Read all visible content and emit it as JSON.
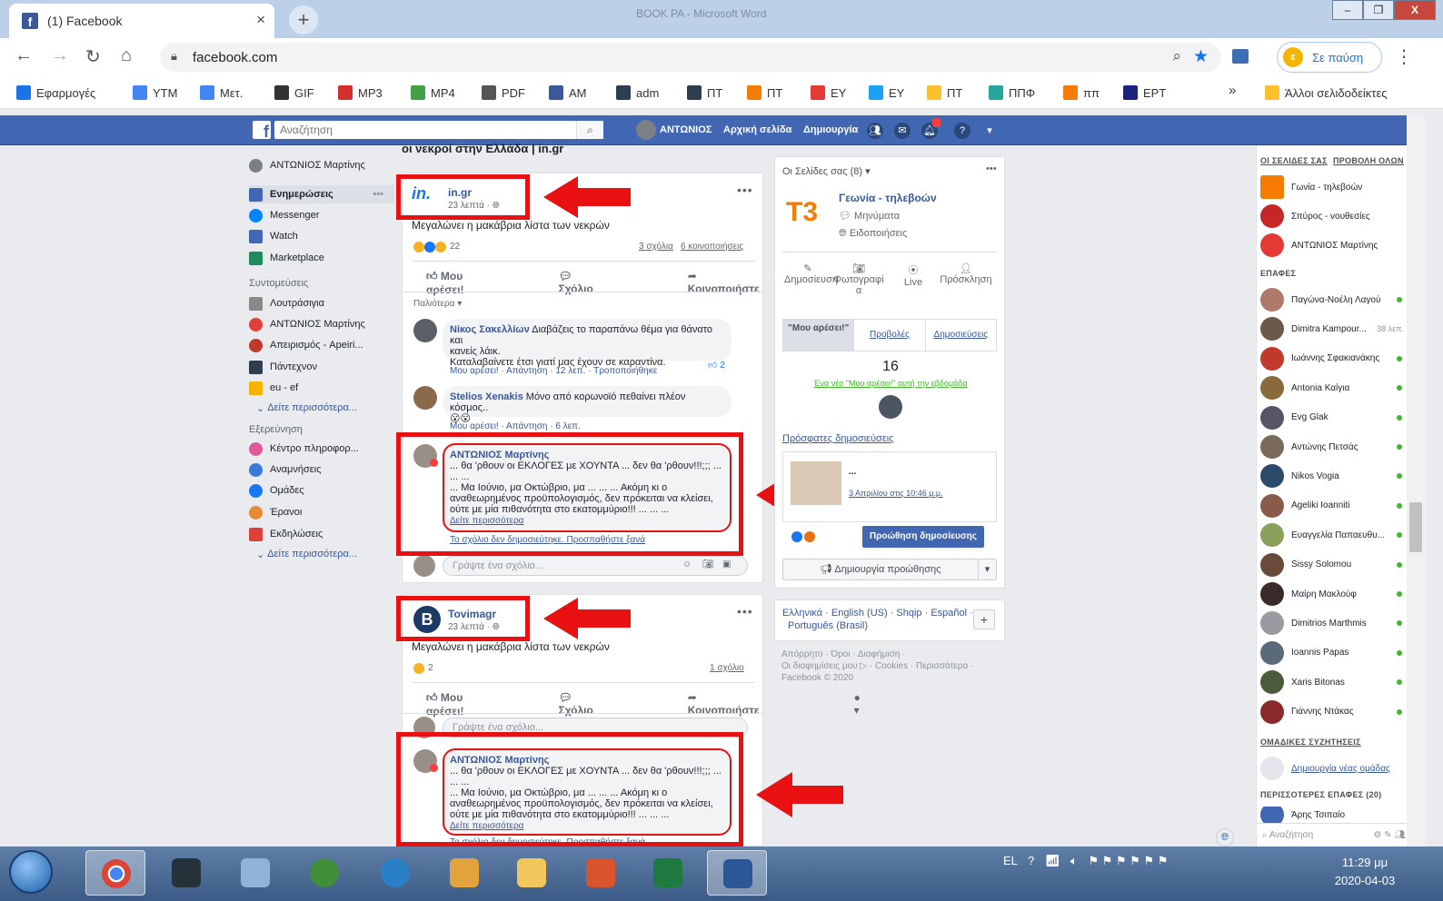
{
  "browser": {
    "tab_title": "(1) Facebook",
    "tab_close": "×",
    "new_tab": "+",
    "window_title": "BOOK PA - Microsoft Word",
    "url": "facebook.com",
    "profile_label": "Σε παύση",
    "bookmarks": [
      {
        "label": "Εφαρμογές",
        "icon": "apps-grid-icon",
        "color": "#1a73e8"
      },
      {
        "label": "YTM",
        "icon": "google-g-icon",
        "color": "#4285f4"
      },
      {
        "label": "Μετ.",
        "icon": "translate-icon",
        "color": "#4285f4"
      },
      {
        "label": "GIF",
        "icon": "globe-icon",
        "color": "#333333"
      },
      {
        "label": "MP3",
        "icon": "youtube-mp3-icon",
        "color": "#d32f2f"
      },
      {
        "label": "MP4",
        "icon": "download-arrow-icon",
        "color": "#43a047"
      },
      {
        "label": "PDF",
        "icon": "pdf-icon",
        "color": "#555555"
      },
      {
        "label": "AM",
        "icon": "facebook-icon",
        "color": "#3b5998"
      },
      {
        "label": "adm",
        "icon": "tool-icon",
        "color": "#2c3e50"
      },
      {
        "label": "ΠΤ",
        "icon": "tool-icon",
        "color": "#2c3e50"
      },
      {
        "label": "ΠΤ",
        "icon": "analytics-icon",
        "color": "#f57c00"
      },
      {
        "label": "EY",
        "icon": "youtube-icon",
        "color": "#e53935"
      },
      {
        "label": "EY",
        "icon": "twitter-icon",
        "color": "#1da1f2"
      },
      {
        "label": "ΠΤ",
        "icon": "folder-icon",
        "color": "#fbc02d"
      },
      {
        "label": "ΠΠΦ",
        "icon": "circle-pp-icon",
        "color": "#26a69a"
      },
      {
        "label": "ππ",
        "icon": "analytics-icon",
        "color": "#f57c00"
      },
      {
        "label": "ΕΡΤ",
        "icon": "ert-icon",
        "color": "#1a237e"
      }
    ],
    "bookmarks_more": "»",
    "other_bookmarks": "Άλλοι σελιδοδείκτες"
  },
  "fb_header": {
    "search_placeholder": "Αναζήτηση",
    "user": "ΑΝΤΩΝΙΟΣ",
    "home": "Αρχική σελίδα",
    "create": "Δημιουργία",
    "notifications_count": "1"
  },
  "left_nav": {
    "profile": "ΑΝΤΩΝΙΟΣ Μαρτίνης",
    "news_feed": "Ενημερώσεις",
    "messenger": "Messenger",
    "watch": "Watch",
    "marketplace": "Marketplace",
    "shortcuts_header": "Συντομεύσεις",
    "shortcuts": [
      "Λουτράσιγια",
      "ΑΝΤΩΝΙΟΣ Μαρτίνης",
      "Απειρισμός - Apeiri...",
      "Πάντεχνον",
      "eu - ef"
    ],
    "see_more_1": "Δείτε περισσότερα...",
    "explore_header": "Εξερεύνηση",
    "explore": [
      "Κέντρο πληροφορ...",
      "Αναμνήσεις",
      "Ομάδες",
      "Έρανοι",
      "Εκδηλώσεις"
    ],
    "see_more_2": "Δείτε περισσότερα..."
  },
  "feed": {
    "top_heading": "οι νεκροί στην Ελλάδα | in.gr",
    "post1": {
      "page": "in.gr",
      "time": "23 λεπτά · ",
      "text": "Μεγαλώνει η μακάβρια λίστα των νεκρών",
      "reaction_count": "22",
      "comments_count": "3 σχόλια",
      "shares_count": "6 κοινοποιήσεις",
      "like": "Μου αρέσει!",
      "comment": "Σχόλιο",
      "share": "Κοινοποιήστε",
      "sort": "Παλιότερα ▾",
      "comments": [
        {
          "name": "Νίκος Σακελλίων",
          "text1": "Διαβάζεις το παραπάνω θέμα για θάνατο και",
          "text2": "κανείς λάικ.",
          "text3": "Καταλαβαίνετε έτσι γιατί μας έχουν σε καραντίνα.",
          "meta": "Μου αρέσει! · Απάντηση · 12 λεπ. · Τροποποιήθηκε",
          "likes": "2"
        },
        {
          "name": "Stelios Xenakis",
          "text1": "Μόνο από κορωνοϊό πεθαίνει πλέον κόσμος..",
          "text2": "😮😮",
          "meta": "Μου αρέσει! · Απάντηση · 6 λεπ."
        }
      ],
      "my_comment": {
        "name": "ΑΝΤΩΝΙΟΣ Μαρτίνης",
        "line1": "... θα 'ρθουν οι ΕΚΛΟΓΕΣ με ΧΟΥΝΤΑ ... δεν θα 'ρθουν!!!;;; ...",
        "line2": "... ...",
        "line3": "... Μα Ιούνιο, μα Οκτώβριο, μα ... ... ... Ακόμη κι ο",
        "line4": "αναθεωρημένος προϋπολογισμός, δεν πρόκειται να κλείσει,",
        "line5": "ούτε με μία πιθανότητα στο εκατομμύριο!!! ... ... ...",
        "see_more": "Δείτε περισσότερα",
        "error": "Το σχόλιο δεν δημοσιεύτηκε. Προσπαθήστε ξανά"
      },
      "write_comment": "Γράψτε ένα σχόλιο..."
    },
    "post2": {
      "page": "Tovimagr",
      "time": "23 λεπτά · ",
      "text": "Μεγαλώνει η μακάβρια λίστα των νεκρών",
      "reaction_count": "2",
      "comments_count": "1 σχόλιο",
      "like": "Μου αρέσει!",
      "comment": "Σχόλιο",
      "share": "Κοινοποιήστε",
      "write_comment": "Γράψτε ένα σχόλιο...",
      "my_comment": {
        "name": "ΑΝΤΩΝΙΟΣ Μαρτίνης",
        "line1": "... θα 'ρθουν οι ΕΚΛΟΓΕΣ με ΧΟΥΝΤΑ ... δεν θα 'ρθουν!!!;;; ...",
        "line2": "... ...",
        "line3": "... Μα Ιούνιο, μα Οκτώβριο, μα ... ... ... Ακόμη κι ο",
        "line4": "αναθεωρημένος προϋπολογισμός, δεν πρόκειται να κλείσει,",
        "line5": "ούτε με μία πιθανότητα στο εκατομμύριο!!! ... ... ...",
        "see_more": "Δείτε περισσότερα",
        "error": "Το σχόλιο δεν δημοσιεύτηκε. Προσπαθήστε ξανά"
      }
    }
  },
  "pages_box": {
    "header": "Οι Σελίδες σας (8) ▾",
    "page_name": "Γεωνία - τηλεβοών",
    "messages": "Μηνύματα",
    "notifications": "Ειδοποιήσεις",
    "actions": [
      "Δημοσίευση",
      "Φωτογραφί α",
      "Live",
      "Πρόσκληση"
    ],
    "tabs": [
      "\"Μου αρέσει!\"",
      "Προβολές",
      "Δημοσιεύσεις"
    ],
    "likes_count": "16",
    "new_like": "Ένα νέο \"Μου αρέσει!\" αυτή την εβδομάδα",
    "recent_posts": "Πρόσφατες δημοσιεύσεις",
    "recent_title": "...",
    "recent_date": "3 Απριλίου στις 10:46 μ.μ.",
    "boost": "Προώθηση δημοσίευσης",
    "create_promo": "Δημιουργία προώθησης"
  },
  "languages": {
    "line1": "Ελληνικά · English (US) · Shqip · Español ·",
    "line2": "Português (Brasil)",
    "add": "+"
  },
  "footer_links": {
    "line1": "Απόρρητο · Όροι · Διαφήμιση ·",
    "line2": "Οι διαφημίσεις μου ▷ · Cookies · Περισσότερα ·",
    "line3": "Facebook © 2020"
  },
  "chat": {
    "hdr_pages": "ΟΙ ΣΕΛΙΔΕΣ ΣΑΣ",
    "hdr_showall": "ΠΡΟΒΟΛΗ ΟΛΩΝ",
    "pages": [
      "Γωνία - τηλεβοών",
      "Σπύρος - vουθεσίες",
      "ΑΝΤΩΝΙΟΣ Μαρτίνης"
    ],
    "hdr_contacts": "ΕΠΑΦΕΣ",
    "contacts": [
      {
        "name": "Παγώνα-Νοέλη Λαγού",
        "time": ""
      },
      {
        "name": "Dimitra Kampour...",
        "time": "38 λεπ."
      },
      {
        "name": "Ιωάννης Σφακιανάκης",
        "time": ""
      },
      {
        "name": "Antonia Καίγια",
        "time": ""
      },
      {
        "name": "Evg Glak",
        "time": ""
      },
      {
        "name": "Αντώνης Πετσάς",
        "time": ""
      },
      {
        "name": "Nikos Vogia",
        "time": ""
      },
      {
        "name": "Ageliki Ioanniti",
        "time": ""
      },
      {
        "name": "Ευαγγελία Παπαευθυ...",
        "time": ""
      },
      {
        "name": "Sissy Solomou",
        "time": ""
      },
      {
        "name": "Μαίρη Μακλούφ",
        "time": ""
      },
      {
        "name": "Dimitrios Marthmis",
        "time": ""
      },
      {
        "name": "Ioannis Papas",
        "time": ""
      },
      {
        "name": "Xaris Bitonas",
        "time": ""
      },
      {
        "name": "Γιάννης Ντάκας",
        "time": ""
      }
    ],
    "hdr_groups": "ΟΜΑΔΙΚΕΣ ΣΥΖΗΤΗΣΕΙΣ",
    "create_group": "Δημιουργία νέας ομάδας",
    "hdr_more": "ΠΕΡΙΣΣΟΤΕΡΕΣ ΕΠΑΦΕΣ (20)",
    "partial_contact": "Άρης Τσιπαίο",
    "search_placeholder": "Αναζήτηση"
  },
  "taskbar": {
    "lang": "EL",
    "time": "11:29 μμ",
    "date": "2020-04-03"
  },
  "colors": {
    "fb_blue": "#4267b2",
    "link_blue": "#385898",
    "annotation_red": "#e81010"
  }
}
